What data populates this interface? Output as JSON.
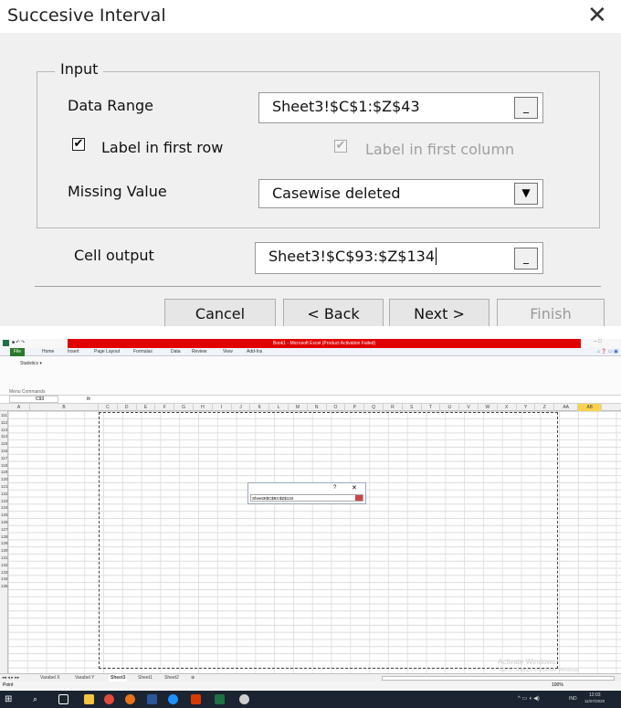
{
  "dialog": {
    "title": "Succesive Interval",
    "close_glyph": "✕",
    "group_label": "Input",
    "data_range_label": "Data Range",
    "data_range_value": "Sheet3!$C$1:$Z$43",
    "label_first_row": "Label in first row",
    "label_first_column": "Label in first column",
    "missing_value_label": "Missing Value",
    "missing_value_selected": "Casewise deleted",
    "cell_output_label": "Cell output",
    "cell_output_value": "Sheet3!$C$93:$Z$134",
    "picker_glyph": "_",
    "dropdown_glyph": "▼",
    "buttons": {
      "cancel": "Cancel",
      "back": "< Back",
      "next": "Next >",
      "finish": "Finish"
    }
  },
  "excel": {
    "title_bar": "Book1 - Microsoft Excel (Product Activation Failed)",
    "tabs": [
      "File",
      "Home",
      "Insert",
      "Page Layout",
      "Formulas",
      "Data",
      "Review",
      "View",
      "Add-Ins"
    ],
    "ribbon_item": "Statistics ▾",
    "ribbon_group": "Menu Commands",
    "name_box": "C93",
    "fx": "fx",
    "columns": [
      "A",
      "B",
      "C",
      "D",
      "E",
      "F",
      "G",
      "H",
      "I",
      "J",
      "K",
      "L",
      "M",
      "N",
      "O",
      "P",
      "Q",
      "R",
      "S",
      "T",
      "U",
      "V",
      "W",
      "X",
      "Y",
      "Z",
      "AA",
      "AB"
    ],
    "rows": [
      "111",
      "112",
      "113",
      "114",
      "115",
      "116",
      "117",
      "118",
      "119",
      "120",
      "121",
      "122",
      "123",
      "124",
      "125",
      "126",
      "127",
      "128",
      "129",
      "130",
      "131",
      "132",
      "133",
      "134",
      "135"
    ],
    "mini_dialog": {
      "help": "?",
      "close": "✕",
      "value": "Sheet3!$C$93:$Z$134"
    },
    "sheet_tabs": [
      "Varabel X",
      "Varabel Y",
      "Sheet3",
      "Sheet1",
      "Sheet2"
    ],
    "active_sheet": "Sheet3",
    "status_mode": "Point",
    "zoom": "100%",
    "activate_line1": "Activate Windows",
    "activate_line2": "Go to Settings to activate Windows.",
    "tray_lang": "IND",
    "tray_time": "12:03",
    "tray_date": "11/07/2020",
    "colors": {
      "title_red": "#e00000",
      "file_tab": "#2a7a2a",
      "taskbar": "#1b2430",
      "active_col": "#ffd24d"
    }
  }
}
